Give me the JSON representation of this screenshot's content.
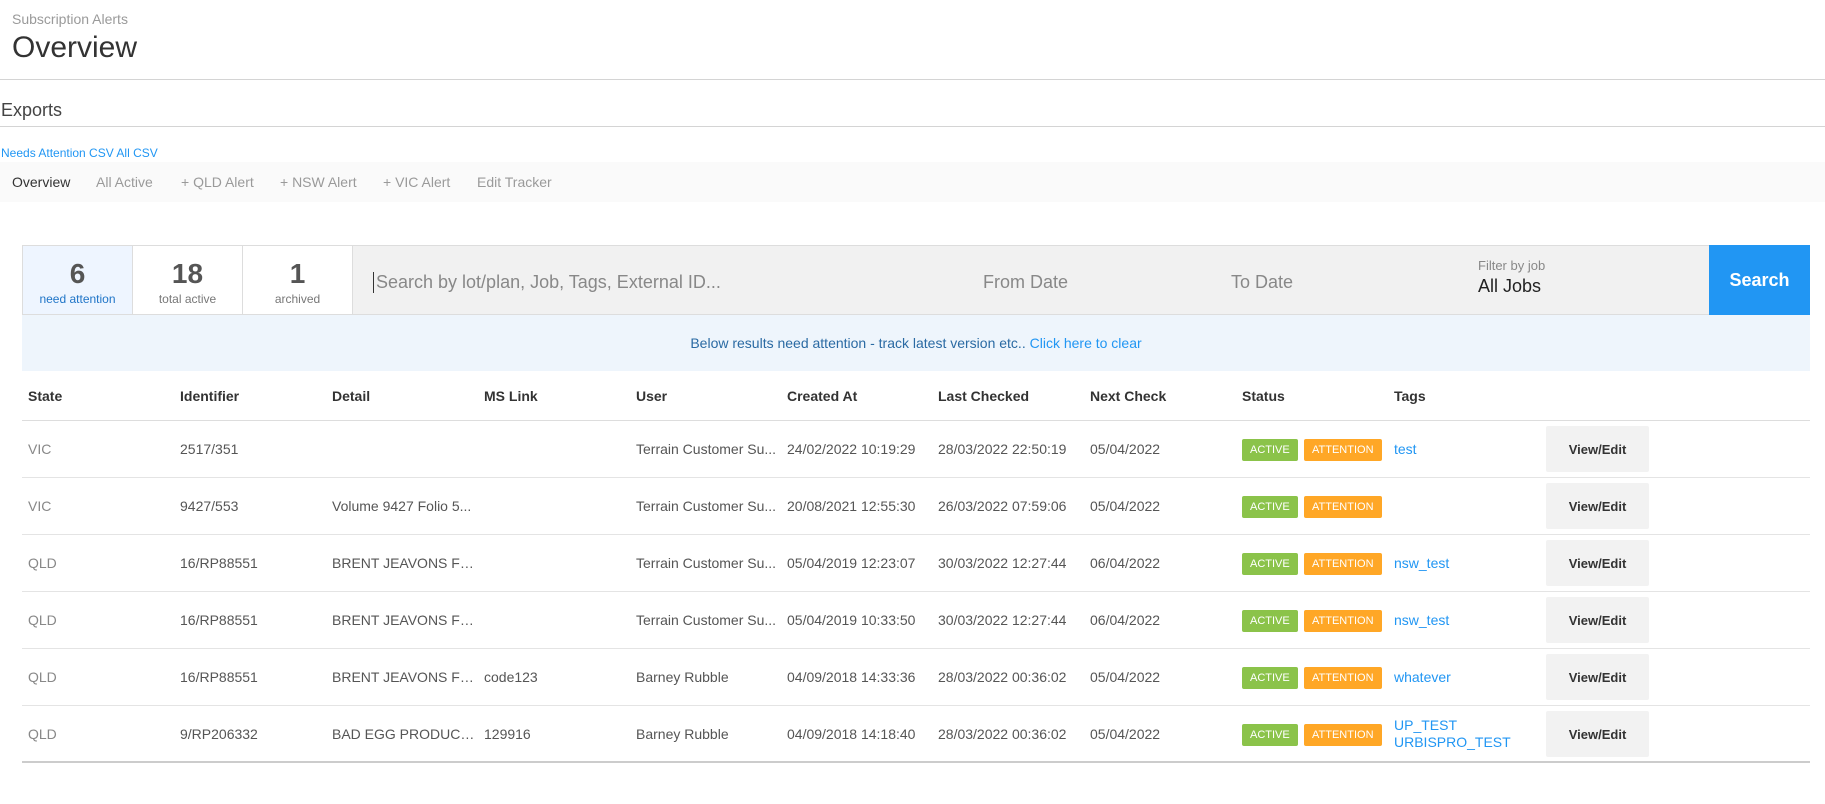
{
  "header": {
    "breadcrumb": "Subscription Alerts",
    "title": "Overview",
    "exports_title": "Exports"
  },
  "exports": {
    "links": [
      "Needs Attention CSV",
      "All CSV"
    ]
  },
  "tabs": [
    {
      "label": "Overview",
      "active": true
    },
    {
      "label": "All Active",
      "active": false
    },
    {
      "label": "+ QLD Alert",
      "active": false
    },
    {
      "label": "+ NSW Alert",
      "active": false
    },
    {
      "label": "+ VIC Alert",
      "active": false
    },
    {
      "label": "Edit Tracker",
      "active": false
    }
  ],
  "stats": [
    {
      "value": "6",
      "label": "need attention",
      "selected": true
    },
    {
      "value": "18",
      "label": "total active",
      "selected": false
    },
    {
      "value": "1",
      "label": "archived",
      "selected": false
    }
  ],
  "search": {
    "placeholder": "Search by lot/plan, Job, Tags, External ID...",
    "value": "",
    "from_date": "From Date",
    "to_date": "To Date",
    "job_filter_caption": "Filter by job",
    "job_filter_value": "All Jobs",
    "button_label": "Search"
  },
  "notice": {
    "text": "Below results need attention - track latest version etc.. ",
    "link": "Click here to clear"
  },
  "table": {
    "columns": [
      "State",
      "Identifier",
      "Detail",
      "MS Link",
      "User",
      "Created At",
      "Last Checked",
      "Next Check",
      "Status",
      "Tags"
    ],
    "status_labels": {
      "active": "ACTIVE",
      "attention": "ATTENTION"
    },
    "action_label": "View/Edit",
    "rows": [
      {
        "state": "VIC",
        "identifier": "2517/351",
        "detail": "",
        "ms_link": "",
        "user": "Terrain Customer Su...",
        "created": "24/02/2022 10:19:29",
        "last_checked": "28/03/2022 22:50:19",
        "next_check": "05/04/2022",
        "tags": [
          "test"
        ]
      },
      {
        "state": "VIC",
        "identifier": "9427/553",
        "detail": "Volume 9427 Folio 5...",
        "ms_link": "",
        "user": "Terrain Customer Su...",
        "created": "20/08/2021 12:55:30",
        "last_checked": "26/03/2022 07:59:06",
        "next_check": "05/04/2022",
        "tags": []
      },
      {
        "state": "QLD",
        "identifier": "16/RP88551",
        "detail": "BRENT JEAVONS FE...",
        "ms_link": "",
        "user": "Terrain Customer Su...",
        "created": "05/04/2019 12:23:07",
        "last_checked": "30/03/2022 12:27:44",
        "next_check": "06/04/2022",
        "tags": [
          "nsw_test"
        ]
      },
      {
        "state": "QLD",
        "identifier": "16/RP88551",
        "detail": "BRENT JEAVONS FE...",
        "ms_link": "",
        "user": "Terrain Customer Su...",
        "created": "05/04/2019 10:33:50",
        "last_checked": "30/03/2022 12:27:44",
        "next_check": "06/04/2022",
        "tags": [
          "nsw_test"
        ]
      },
      {
        "state": "QLD",
        "identifier": "16/RP88551",
        "detail": "BRENT JEAVONS FE...",
        "ms_link": "code123",
        "user": "Barney Rubble",
        "created": "04/09/2018 14:33:36",
        "last_checked": "28/03/2022 00:36:02",
        "next_check": "05/04/2022",
        "tags": [
          "whatever"
        ]
      },
      {
        "state": "QLD",
        "identifier": "9/RP206332",
        "detail": "BAD EGG PRODUCE...",
        "ms_link": "129916",
        "user": "Barney Rubble",
        "created": "04/09/2018 14:18:40",
        "last_checked": "28/03/2022 00:36:02",
        "next_check": "05/04/2022",
        "tags": [
          "UP_TEST",
          "URBISPRO_TEST"
        ]
      }
    ]
  },
  "colors": {
    "accent": "#2196f3",
    "active_badge": "#8bc34a",
    "attention_badge": "#ffa726",
    "notice_bg": "#eef5fc"
  }
}
